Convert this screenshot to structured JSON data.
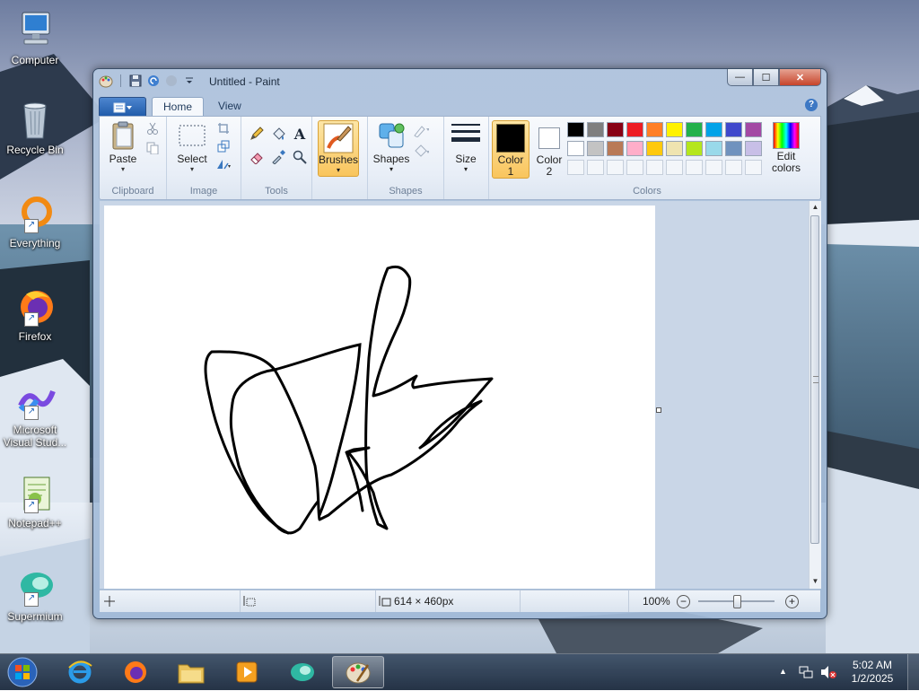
{
  "desktop": {
    "icons": [
      {
        "label": "Computer"
      },
      {
        "label": "Recycle Bin"
      },
      {
        "label": "Everything"
      },
      {
        "label": "Firefox"
      },
      {
        "label": "Microsoft Visual Stud..."
      },
      {
        "label": "Notepad++"
      },
      {
        "label": "Supermium"
      }
    ]
  },
  "window": {
    "title": "Untitled - Paint",
    "tabs": {
      "home": "Home",
      "view": "View"
    },
    "help": "?",
    "controls": {
      "minimize": "—",
      "maximize": "☐",
      "close": "✕"
    }
  },
  "ribbon": {
    "clipboard": {
      "paste": "Paste",
      "label": "Clipboard"
    },
    "image": {
      "select": "Select",
      "label": "Image"
    },
    "tools": {
      "label": "Tools",
      "text_tool": "A"
    },
    "brushes": {
      "label": "Brushes"
    },
    "shapes": {
      "shapes": "Shapes",
      "label": "Shapes"
    },
    "size": {
      "label": "Size"
    },
    "colors": {
      "color1_line1": "Color",
      "color1_line2": "1",
      "color2_line1": "Color",
      "color2_line2": "2",
      "edit_line1": "Edit",
      "edit_line2": "colors",
      "label": "Colors",
      "color1_value": "#000000",
      "color2_value": "#ffffff",
      "palette_row1": [
        "#000000",
        "#7f7f7f",
        "#880015",
        "#ed1c24",
        "#ff7f27",
        "#fff200",
        "#22b14c",
        "#00a2e8",
        "#3f48cc",
        "#a349a4"
      ],
      "palette_row2": [
        "#ffffff",
        "#c3c3c3",
        "#b97a57",
        "#ffaec9",
        "#ffc90e",
        "#efe4b0",
        "#b5e61d",
        "#99d9ea",
        "#7092be",
        "#c8bfe7"
      ]
    }
  },
  "status": {
    "canvas_size": "614 × 460px",
    "zoom": "100%"
  },
  "taskbar": {
    "clock_time": "5:02 AM",
    "clock_date": "1/2/2025"
  }
}
